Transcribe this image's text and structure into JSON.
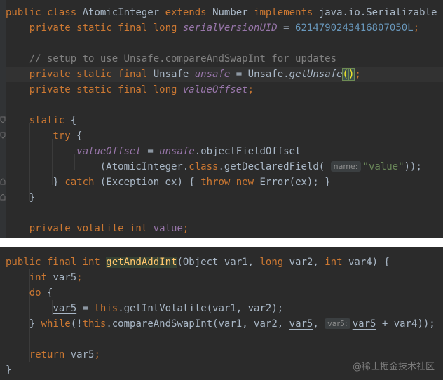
{
  "snippet1": {
    "l1": {
      "kw": "public class",
      "name": "AtomicInteger",
      "kw2": "extends",
      "parent": "Number",
      "kw3": "implements",
      "iface": "java.io.Serializable",
      "brace": "{"
    },
    "l2": {
      "mods": "private static final long",
      "field": "serialVersionUID",
      "eq": "=",
      "value": "6214790243416807050L",
      "semi": ";"
    },
    "l3": {
      "comment": "// setup to use Unsafe.compareAndSwapInt for updates"
    },
    "l4": {
      "mods": "private static final",
      "type": "Unsafe",
      "field": "unsafe",
      "eq": "=",
      "cls": "Unsafe.",
      "method": "getUnsafe",
      "open": "(",
      "close": ")",
      "semi": ";"
    },
    "l5": {
      "mods": "private static final long",
      "field": "valueOffset",
      "semi": ";"
    },
    "l6": {
      "kw": "static",
      "brace": "{"
    },
    "l7": {
      "kw": "try",
      "brace": "{"
    },
    "l8": {
      "field": "valueOffset",
      "eq": "=",
      "obj": "unsafe",
      "call": ".objectFieldOffset"
    },
    "l9": {
      "pre": "(AtomicInteger.",
      "kw": "class",
      "call": ".getDeclaredField(",
      "hint": "name:",
      "str": "\"value\"",
      "post": "));"
    },
    "l10": {
      "close": "}",
      "kw": "catch",
      "mid": "(Exception ex) {",
      "kw2": "throw new",
      "post": "Error(ex);",
      "close2": "}"
    },
    "l11": {
      "close": "}"
    },
    "l12": {
      "mods": "private volatile int",
      "field": "value",
      "semi": ";"
    }
  },
  "snippet2": {
    "l1": {
      "mods": "public final int",
      "method": "getAndAddInt",
      "p1": "(Object var1,",
      "kw1": "long",
      "p2": "var2,",
      "kw2": "int",
      "p3": "var4) {"
    },
    "l2": {
      "kw": "int",
      "var": "var5",
      "semi": ";"
    },
    "l3": {
      "kw": "do",
      "brace": "{"
    },
    "l4": {
      "var": "var5",
      "eq": "=",
      "kw": "this",
      "call": ".getIntVolatile(var1, var2);"
    },
    "l5": {
      "close": "}",
      "kw": "while",
      "pre": "(!",
      "kw2": "this",
      "call": ".compareAndSwapInt(var1, var2,",
      "var": "var5",
      "comma": ",",
      "hint": "var5:",
      "var2": "var5",
      "post": "+ var4));"
    },
    "l6": {
      "kw": "return",
      "var": "var5",
      "semi": ";"
    },
    "l7": {
      "close": "}"
    }
  },
  "watermark": "@稀土掘金技术社区",
  "colors": {
    "background": "#2b2b2b",
    "keyword": "#cc7832",
    "field": "#9876aa",
    "number": "#6897bb",
    "string": "#6a8759",
    "comment": "#808080",
    "method": "#ffc66d",
    "text": "#a9b7c6"
  }
}
